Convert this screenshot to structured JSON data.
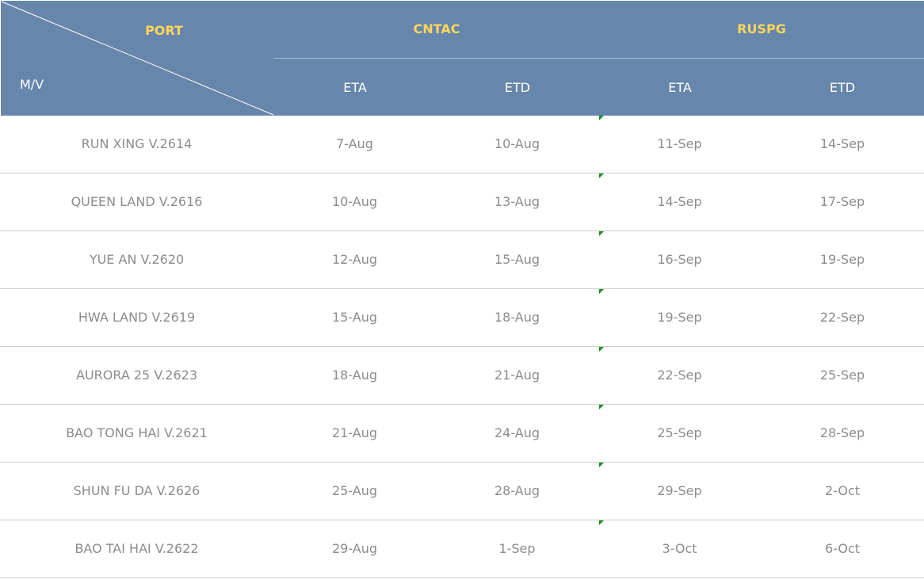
{
  "header": {
    "corner_top": "PORT",
    "corner_bottom": "M/V",
    "ports": [
      "CNTAC",
      "RUSPG"
    ],
    "subcols": [
      "ETA",
      "ETD",
      "ETA",
      "ETD"
    ]
  },
  "rows": [
    {
      "vessel": "RUN XING V.2614",
      "cntac_eta": "7-Aug",
      "cntac_etd": "10-Aug",
      "ruspg_eta": "11-Sep",
      "ruspg_etd": "14-Sep"
    },
    {
      "vessel": "QUEEN LAND V.2616",
      "cntac_eta": "10-Aug",
      "cntac_etd": "13-Aug",
      "ruspg_eta": "14-Sep",
      "ruspg_etd": "17-Sep"
    },
    {
      "vessel": "YUE AN V.2620",
      "cntac_eta": "12-Aug",
      "cntac_etd": "15-Aug",
      "ruspg_eta": "16-Sep",
      "ruspg_etd": "19-Sep"
    },
    {
      "vessel": "HWA LAND V.2619",
      "cntac_eta": "15-Aug",
      "cntac_etd": "18-Aug",
      "ruspg_eta": "19-Sep",
      "ruspg_etd": "22-Sep"
    },
    {
      "vessel": "AURORA 25 V.2623",
      "cntac_eta": "18-Aug",
      "cntac_etd": "21-Aug",
      "ruspg_eta": "22-Sep",
      "ruspg_etd": "25-Sep"
    },
    {
      "vessel": "BAO TONG HAI V.2621",
      "cntac_eta": "21-Aug",
      "cntac_etd": "24-Aug",
      "ruspg_eta": "25-Sep",
      "ruspg_etd": "28-Sep"
    },
    {
      "vessel": "SHUN FU DA V.2626",
      "cntac_eta": "25-Aug",
      "cntac_etd": "28-Aug",
      "ruspg_eta": "29-Sep",
      "ruspg_etd": "2-Oct"
    },
    {
      "vessel": "BAO TAI HAI V.2622",
      "cntac_eta": "29-Aug",
      "cntac_etd": "1-Sep",
      "ruspg_eta": "3-Oct",
      "ruspg_etd": "6-Oct"
    }
  ],
  "colors": {
    "header_bg": "#6786ab",
    "port_text": "#ffd65c",
    "header_text": "#ffffff",
    "cell_text": "#8c8c8c",
    "row_rule": "#cfcfcf",
    "cell_marker": "#1a8f1a"
  }
}
